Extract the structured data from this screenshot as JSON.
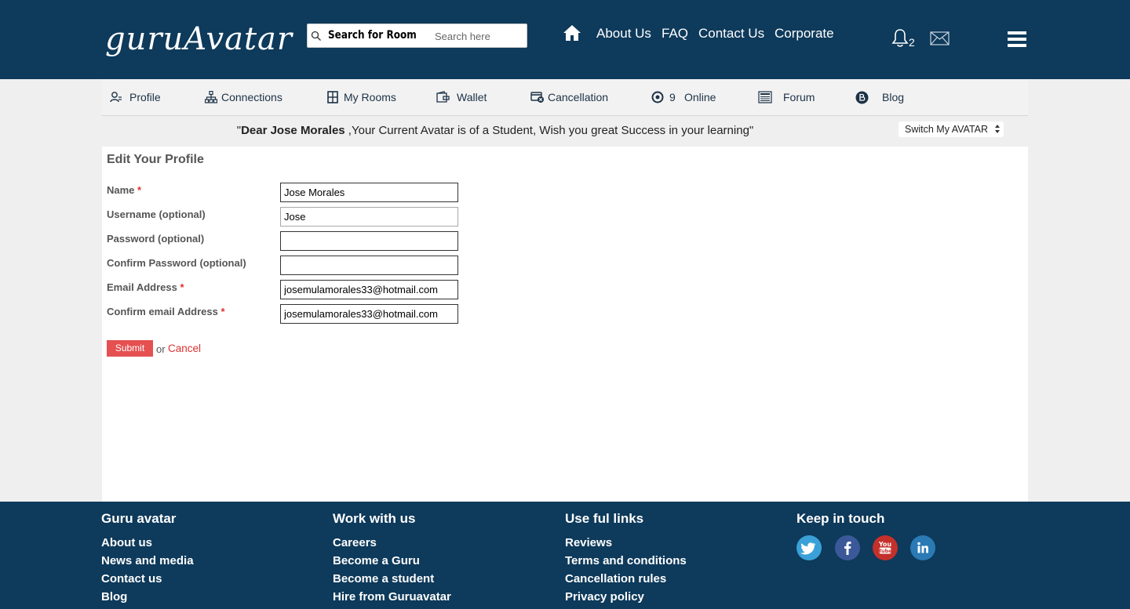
{
  "header": {
    "logo_text": "guruAvatar",
    "search_label": "Search for Room",
    "search_placeholder": "Search here",
    "nav": [
      "About Us",
      "FAQ",
      "Contact Us",
      "Corporate"
    ],
    "notification_count": "2"
  },
  "subnav": {
    "items": [
      {
        "label": "Profile",
        "icon": "user-icon"
      },
      {
        "label": "Connections",
        "icon": "network-icon"
      },
      {
        "label": "My Rooms",
        "icon": "rooms-icon"
      },
      {
        "label": "Wallet",
        "icon": "wallet-icon"
      },
      {
        "label": "Cancellation",
        "icon": "cancellation-icon"
      },
      {
        "label": "Online",
        "count": "9",
        "icon": "online-icon"
      },
      {
        "label": "Forum",
        "icon": "forum-icon"
      },
      {
        "label": "Blog",
        "icon": "blog-icon"
      }
    ]
  },
  "welcome": {
    "prefix": "\"",
    "name": "Dear Jose Morales",
    "message": " ,Your Current Avatar is of a Student, Wish you great Success in your learning\"",
    "switch_label": "Switch My AVATAR"
  },
  "form": {
    "title": "Edit Your Profile",
    "fields": [
      {
        "label": "Name",
        "required": true,
        "value": ""
      },
      {
        "label": "Username (optional)",
        "required": false,
        "value": ""
      },
      {
        "label": "Password (optional)",
        "required": false,
        "value": ""
      },
      {
        "label": "Confirm Password (optional)",
        "required": false,
        "value": ""
      },
      {
        "label": "Email Address",
        "required": true,
        "value": ""
      },
      {
        "label": "Confirm email Address",
        "required": true,
        "value": ""
      }
    ],
    "values": {
      "name": "Jose Morales",
      "username": "Jose",
      "password": "",
      "confirm_password": "",
      "email": "josemulamorales33@hotmail.com",
      "confirm_email": "josemulamorales33@hotmail.com"
    },
    "required_mark": "*",
    "submit_label": "Submit",
    "or_text": "or",
    "cancel_label": "Cancel"
  },
  "footer": {
    "columns": [
      {
        "title": "Guru avatar",
        "links": [
          "About us",
          "News and media",
          "Contact us",
          "Blog"
        ]
      },
      {
        "title": "Work with us",
        "links": [
          "Careers",
          "Become a Guru",
          "Become a student",
          "Hire from Guruavatar"
        ]
      },
      {
        "title": "Use ful links",
        "links": [
          "Reviews",
          "Terms and conditions",
          "Cancellation rules",
          "Privacy policy"
        ]
      },
      {
        "title": "Keep in touch",
        "links": []
      }
    ],
    "social": [
      "twitter-icon",
      "facebook-icon",
      "youtube-icon",
      "linkedin-icon"
    ]
  },
  "colors": {
    "header_bg": "#0e3a5b",
    "accent_red": "#e55050",
    "twitter": "#3aa1d8",
    "facebook": "#3b5998",
    "youtube": "#c4302b",
    "linkedin": "#2a7ab5"
  }
}
